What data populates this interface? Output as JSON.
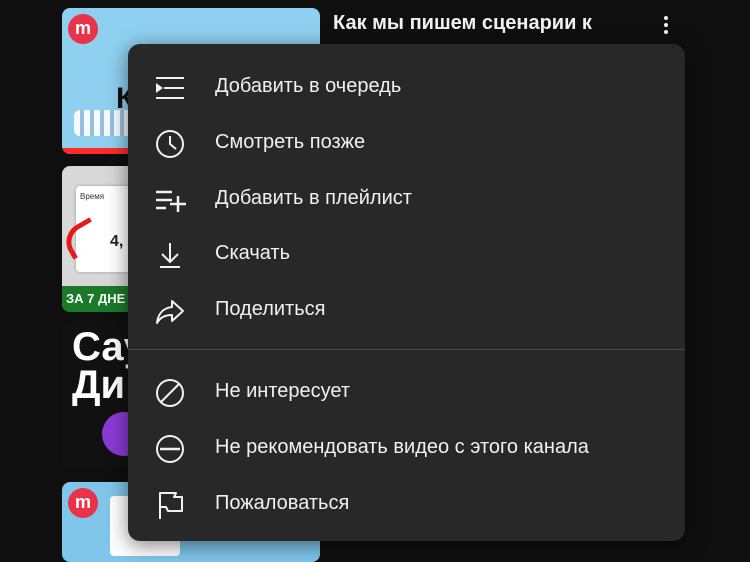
{
  "video": {
    "title": "Как мы пишем сценарии к"
  },
  "thumbnails": {
    "logo_letter": "m",
    "t1_letter": "К",
    "t2_card_top": "Время",
    "t2_card_bottom": "4,",
    "t2_badge": "ЗА 7 ДНЕ",
    "t3_text_line1": "Сау",
    "t3_text_line2": "Ди"
  },
  "menu": {
    "items": [
      {
        "label": "Добавить в очередь",
        "icon": "queue-icon"
      },
      {
        "label": "Смотреть позже",
        "icon": "clock-icon"
      },
      {
        "label": "Добавить в плейлист",
        "icon": "playlist-add-icon"
      },
      {
        "label": "Скачать",
        "icon": "download-icon"
      },
      {
        "label": "Поделиться",
        "icon": "share-icon"
      },
      {
        "label": "Не интересует",
        "icon": "not-interested-icon"
      },
      {
        "label": "Не рекомендовать видео с этого канала",
        "icon": "dont-recommend-icon"
      },
      {
        "label": "Пожаловаться",
        "icon": "flag-icon"
      }
    ]
  },
  "colors": {
    "background": "#0f0f0f",
    "menu_background": "#282828",
    "text": "#f1f1f1",
    "divider": "#4a4a4a"
  }
}
